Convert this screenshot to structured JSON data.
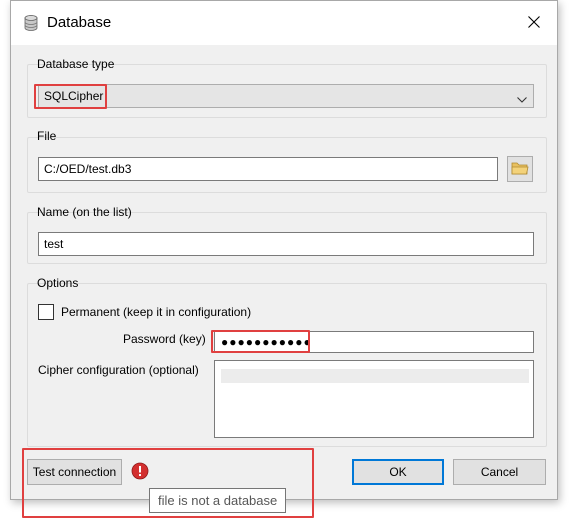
{
  "window": {
    "title": "Database",
    "icon": "database-icon",
    "close_icon": "close-icon"
  },
  "database_type": {
    "label": "Database type",
    "selected": "SQLCipher"
  },
  "file": {
    "label": "File",
    "path": "C:/OED/test.db3",
    "browse_icon": "folder-icon"
  },
  "name": {
    "label": "Name (on the list)",
    "value": "test"
  },
  "options": {
    "label": "Options",
    "permanent_label": "Permanent (keep it in configuration)",
    "permanent_checked": false,
    "password_label": "Password (key)",
    "password_value": "●●●●●●●●●●●",
    "cipher_label": "Cipher configuration (optional)",
    "cipher_value": ""
  },
  "buttons": {
    "test_connection": "Test connection",
    "ok": "OK",
    "cancel": "Cancel"
  },
  "status": {
    "error_icon": "error-icon",
    "tooltip": "file is not a database"
  },
  "colors": {
    "highlight": "#e04040",
    "error": "#d32f2f",
    "ok_border": "#0078d7"
  }
}
